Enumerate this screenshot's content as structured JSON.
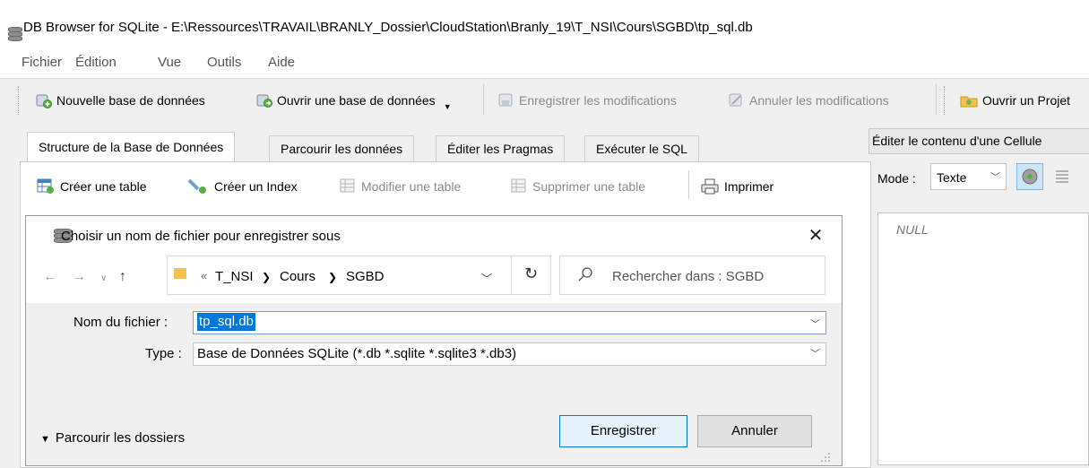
{
  "window": {
    "title": "DB Browser for SQLite - E:\\Ressources\\TRAVAIL\\BRANLY_Dossier\\CloudStation\\Branly_19\\T_NSI\\Cours\\SGBD\\tp_sql.db"
  },
  "menu": [
    "Fichier",
    "Édition",
    "Vue",
    "Outils",
    "Aide"
  ],
  "toolbar": {
    "new_db": "Nouvelle base de données",
    "open_db": "Ouvrir une base de données",
    "write_changes": "Enregistrer les modifications",
    "revert_changes": "Annuler les modifications",
    "open_project": "Ouvrir un Projet"
  },
  "tabs": [
    "Structure de la Base de Données",
    "Parcourir les données",
    "Éditer les Pragmas",
    "Exécuter le SQL"
  ],
  "structure_toolbar": {
    "create_table": "Créer une table",
    "create_index": "Créer un Index",
    "modify_table": "Modifier une table",
    "delete_table": "Supprimer une table",
    "print": "Imprimer"
  },
  "edit_cell": {
    "title": "Éditer le contenu d'une Cellule",
    "mode_label": "Mode :",
    "mode_value": "Texte",
    "content": "NULL"
  },
  "dialog": {
    "title": "Choisir un nom de fichier pour enregistrer sous",
    "close": "✕",
    "path_prefix": "«",
    "path": [
      "T_NSI",
      "Cours",
      "SGBD"
    ],
    "search_placeholder": "Rechercher dans : SGBD",
    "filename_label": "Nom du fichier :",
    "filename_value": "tp_sql.db",
    "type_label": "Type :",
    "type_value": "Base de Données SQLite (*.db *.sqlite *.sqlite3 *.db3)",
    "browse_folders": "Parcourir les dossiers",
    "save": "Enregistrer",
    "cancel": "Annuler"
  },
  "colors": {
    "accent": "#0078d7",
    "selection": "#0078d7",
    "folder": "#f3c24a"
  }
}
